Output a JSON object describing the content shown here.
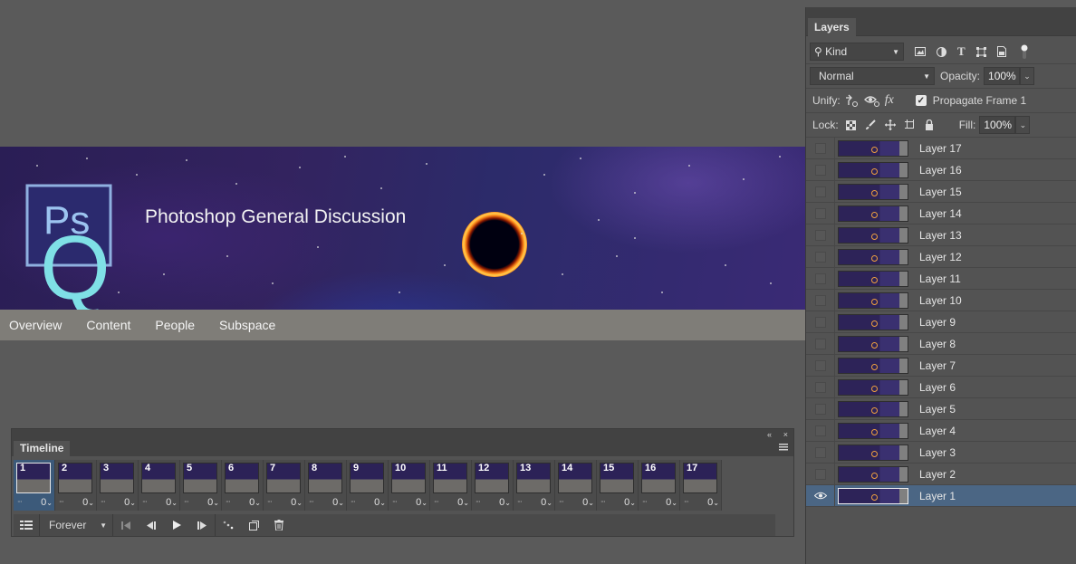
{
  "banner": {
    "title": "Photoshop General Discussion",
    "logo_letters": "Ps",
    "logo_overlay_letter": "Q",
    "nav": [
      "Overview",
      "Content",
      "People",
      "Subspace"
    ]
  },
  "timeline": {
    "tab_label": "Timeline",
    "collapse_glyph": "«",
    "close_glyph": "×",
    "frames": [
      {
        "num": "1",
        "delay": "0"
      },
      {
        "num": "2",
        "delay": "0"
      },
      {
        "num": "3",
        "delay": "0"
      },
      {
        "num": "4",
        "delay": "0"
      },
      {
        "num": "5",
        "delay": "0"
      },
      {
        "num": "6",
        "delay": "0"
      },
      {
        "num": "7",
        "delay": "0"
      },
      {
        "num": "8",
        "delay": "0"
      },
      {
        "num": "9",
        "delay": "0"
      },
      {
        "num": "10",
        "delay": "0"
      },
      {
        "num": "11",
        "delay": "0"
      },
      {
        "num": "12",
        "delay": "0"
      },
      {
        "num": "13",
        "delay": "0"
      },
      {
        "num": "14",
        "delay": "0"
      },
      {
        "num": "15",
        "delay": "0"
      },
      {
        "num": "16",
        "delay": "0"
      },
      {
        "num": "17",
        "delay": "0"
      }
    ],
    "selected_frame": "1",
    "loop_label": "Forever"
  },
  "layers_panel": {
    "tab_label": "Layers",
    "filter_kind": "Kind",
    "blend_mode": "Normal",
    "opacity_label": "Opacity:",
    "opacity_value": "100%",
    "unify_label": "Unify:",
    "propagate_label": "Propagate Frame 1",
    "lock_label": "Lock:",
    "fill_label": "Fill:",
    "fill_value": "100%",
    "layers": [
      "Layer 17",
      "Layer 16",
      "Layer 15",
      "Layer 14",
      "Layer 13",
      "Layer 12",
      "Layer 11",
      "Layer 10",
      "Layer 9",
      "Layer 8",
      "Layer 7",
      "Layer 6",
      "Layer 5",
      "Layer 4",
      "Layer 3",
      "Layer 2",
      "Layer 1"
    ],
    "selected_layer": "Layer 1"
  },
  "colors": {
    "selection": "#4b6684",
    "logo_cyan": "#7fe0e6",
    "logo_border": "#8fb0e0"
  }
}
